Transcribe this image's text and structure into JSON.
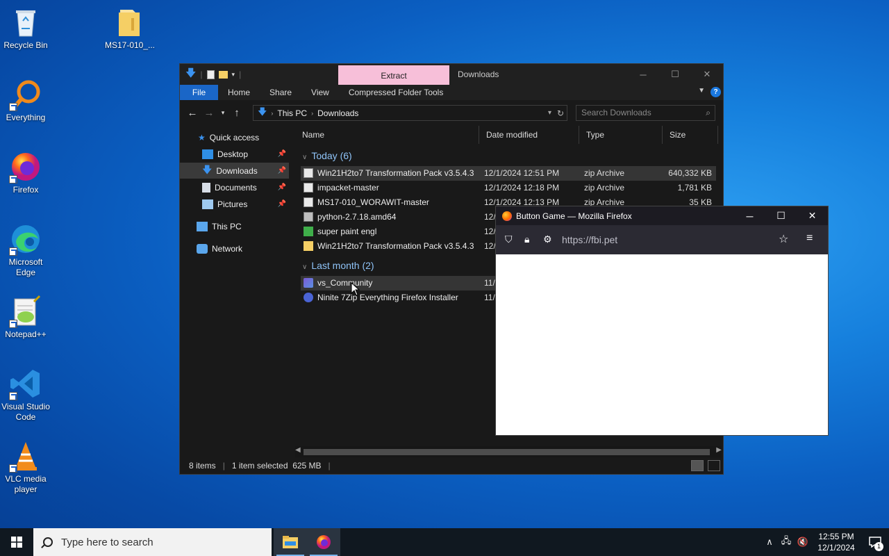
{
  "desktop": {
    "icons": [
      {
        "label": "Recycle Bin"
      },
      {
        "label": "MS17-010_..."
      },
      {
        "label": "Everything"
      },
      {
        "label": "Firefox"
      },
      {
        "label": "Microsoft Edge"
      },
      {
        "label": "Notepad++"
      },
      {
        "label": "Visual Studio Code"
      },
      {
        "label": "VLC media player"
      }
    ]
  },
  "explorer": {
    "contextual_tab": "Extract",
    "title": "Downloads",
    "ribbon_tabs": [
      "File",
      "Home",
      "Share",
      "View",
      "Compressed Folder Tools"
    ],
    "breadcrumb": [
      "This PC",
      "Downloads"
    ],
    "search_placeholder": "Search Downloads",
    "nav": {
      "quick_access": "Quick access",
      "desktop": "Desktop",
      "downloads": "Downloads",
      "documents": "Documents",
      "pictures": "Pictures",
      "this_pc": "This PC",
      "network": "Network"
    },
    "columns": [
      "Name",
      "Date modified",
      "Type",
      "Size"
    ],
    "groups": {
      "today": "Today (6)",
      "last_month": "Last month (2)"
    },
    "files_today": [
      {
        "name": "Win21H2to7 Transformation Pack v3.5.4.3",
        "date": "12/1/2024 12:51 PM",
        "type": "zip Archive",
        "size": "640,332 KB"
      },
      {
        "name": "impacket-master",
        "date": "12/1/2024 12:18 PM",
        "type": "zip Archive",
        "size": "1,781 KB"
      },
      {
        "name": "MS17-010_WORAWIT-master",
        "date": "12/1/2024 12:13 PM",
        "type": "zip Archive",
        "size": "35 KB"
      },
      {
        "name": "python-2.7.18.amd64",
        "date": "12/",
        "type": "",
        "size": ""
      },
      {
        "name": "super paint engl",
        "date": "12/",
        "type": "",
        "size": ""
      },
      {
        "name": "Win21H2to7 Transformation Pack v3.5.4.3",
        "date": "12/",
        "type": "",
        "size": ""
      }
    ],
    "files_last_month": [
      {
        "name": "vs_Community",
        "date": "11/",
        "type": "",
        "size": ""
      },
      {
        "name": "Ninite 7Zip Everything Firefox Installer",
        "date": "11/",
        "type": "",
        "size": ""
      }
    ],
    "status": {
      "items": "8 items",
      "selected": "1 item selected  625 MB"
    }
  },
  "firefox": {
    "title": "Button Game — Mozilla Firefox",
    "url": "https://fbi.pet"
  },
  "taskbar": {
    "search_placeholder": "Type here to search",
    "time": "12:55 PM",
    "date": "12/1/2024",
    "notification_count": "1"
  },
  "colors": {
    "extract_tab": "#f7bfd9",
    "file_tab": "#1a66c7",
    "group_header": "#8fc3f7"
  }
}
